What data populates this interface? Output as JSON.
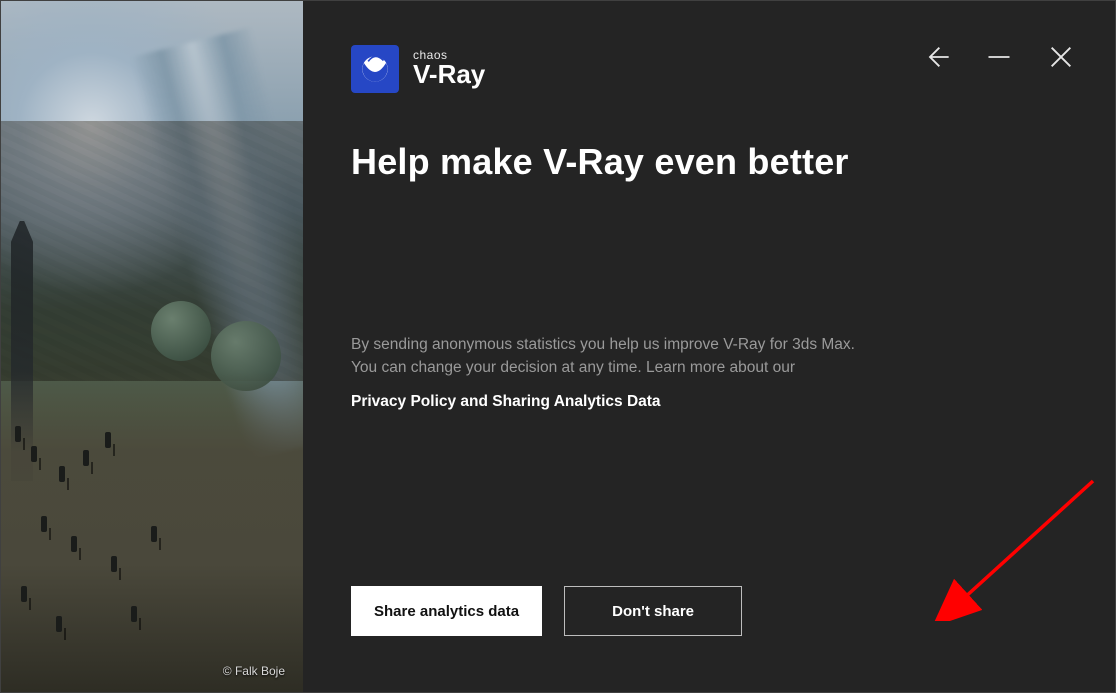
{
  "brand": {
    "super": "chaos",
    "name": "V-Ray"
  },
  "titlebar": {
    "back_icon": "back-arrow-icon",
    "minimize_icon": "minimize-icon",
    "close_icon": "close-icon"
  },
  "heading": "Help make V-Ray even better",
  "body": {
    "line1": "By sending anonymous statistics you help us improve V-Ray for 3ds Max.",
    "line2": "You can change your decision at any time. Learn more about our",
    "link": "Privacy Policy and Sharing Analytics Data"
  },
  "buttons": {
    "primary": "Share analytics data",
    "secondary": "Don't share"
  },
  "art": {
    "credit": "© Falk Boje"
  },
  "annotation": {
    "target": "dont-share-button"
  }
}
